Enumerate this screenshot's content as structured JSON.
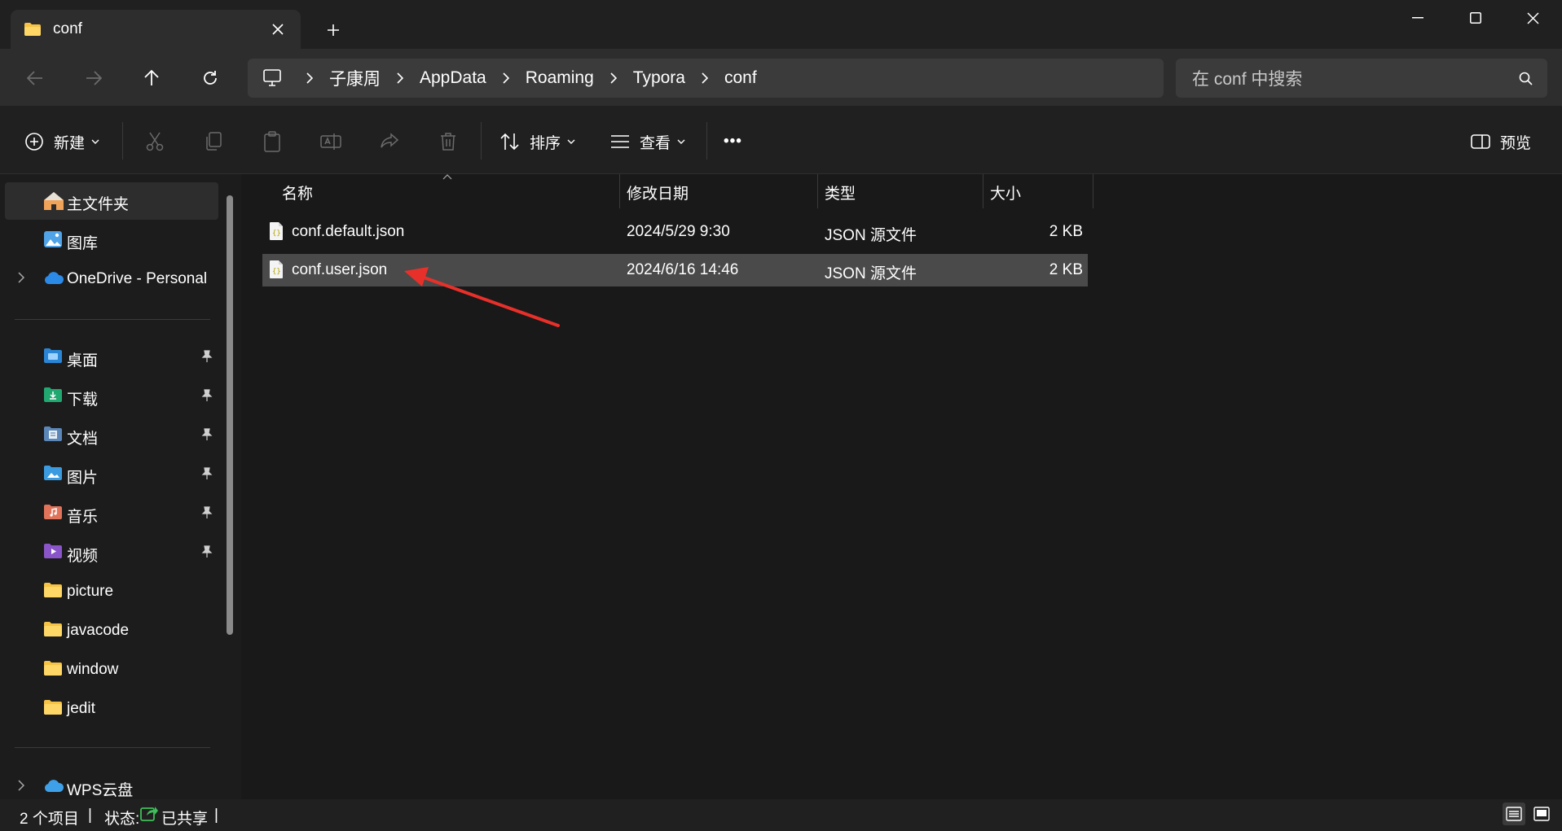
{
  "window": {
    "tab_title": "conf",
    "new_tab": "+",
    "controls": [
      "minimize-icon",
      "maximize-icon",
      "close-icon"
    ]
  },
  "navigation": {
    "buttons": [
      "back-icon",
      "forward-icon",
      "up-icon",
      "refresh-icon"
    ],
    "breadcrumb": [
      "子康周",
      "AppData",
      "Roaming",
      "Typora",
      "conf"
    ],
    "search_placeholder": "在 conf 中搜索"
  },
  "command_bar": {
    "new_label": "新建",
    "sort_label": "排序",
    "view_label": "查看",
    "more_label": "•••",
    "preview_label": "预览",
    "icons": [
      "cut-icon",
      "copy-icon",
      "paste-icon",
      "rename-icon",
      "share-icon",
      "delete-icon"
    ]
  },
  "sidebar": {
    "quick": [
      {
        "label": "主文件夹",
        "icon": "home-icon",
        "selected": true
      },
      {
        "label": "图库",
        "icon": "gallery-icon"
      },
      {
        "label": "OneDrive - Personal",
        "icon": "cloud-icon",
        "expandable": true
      }
    ],
    "pinned": [
      {
        "label": "桌面",
        "icon": "desktop-folder-icon",
        "pinned": true
      },
      {
        "label": "下载",
        "icon": "downloads-folder-icon",
        "pinned": true
      },
      {
        "label": "文档",
        "icon": "documents-folder-icon",
        "pinned": true
      },
      {
        "label": "图片",
        "icon": "pictures-folder-icon",
        "pinned": true
      },
      {
        "label": "音乐",
        "icon": "music-folder-icon",
        "pinned": true
      },
      {
        "label": "视频",
        "icon": "videos-folder-icon",
        "pinned": true
      },
      {
        "label": "picture",
        "icon": "folder-icon"
      },
      {
        "label": "javacode",
        "icon": "folder-icon"
      },
      {
        "label": "window",
        "icon": "folder-icon"
      },
      {
        "label": "jedit",
        "icon": "folder-icon"
      }
    ],
    "bottom": [
      {
        "label": "WPS云盘",
        "icon": "wps-cloud-icon",
        "expandable": true
      }
    ]
  },
  "file_list": {
    "columns": [
      "名称",
      "修改日期",
      "类型",
      "大小"
    ],
    "rows": [
      {
        "name": "conf.default.json",
        "date": "2024/5/29 9:30",
        "type": "JSON 源文件",
        "size": "2 KB",
        "selected": false
      },
      {
        "name": "conf.user.json",
        "date": "2024/6/16 14:46",
        "type": "JSON 源文件",
        "size": "2 KB",
        "selected": true
      }
    ]
  },
  "annotation": {
    "color": "#e8302a"
  },
  "status_bar": {
    "item_count": "2 个项目",
    "divider": "|",
    "status_label": "状态:",
    "status_value": "已共享",
    "divider2": "|"
  },
  "colors": {
    "background": "#191919",
    "selection": "#4a4a4a",
    "folder": "#f6c344",
    "accent_blue": "#4fa3e6"
  }
}
